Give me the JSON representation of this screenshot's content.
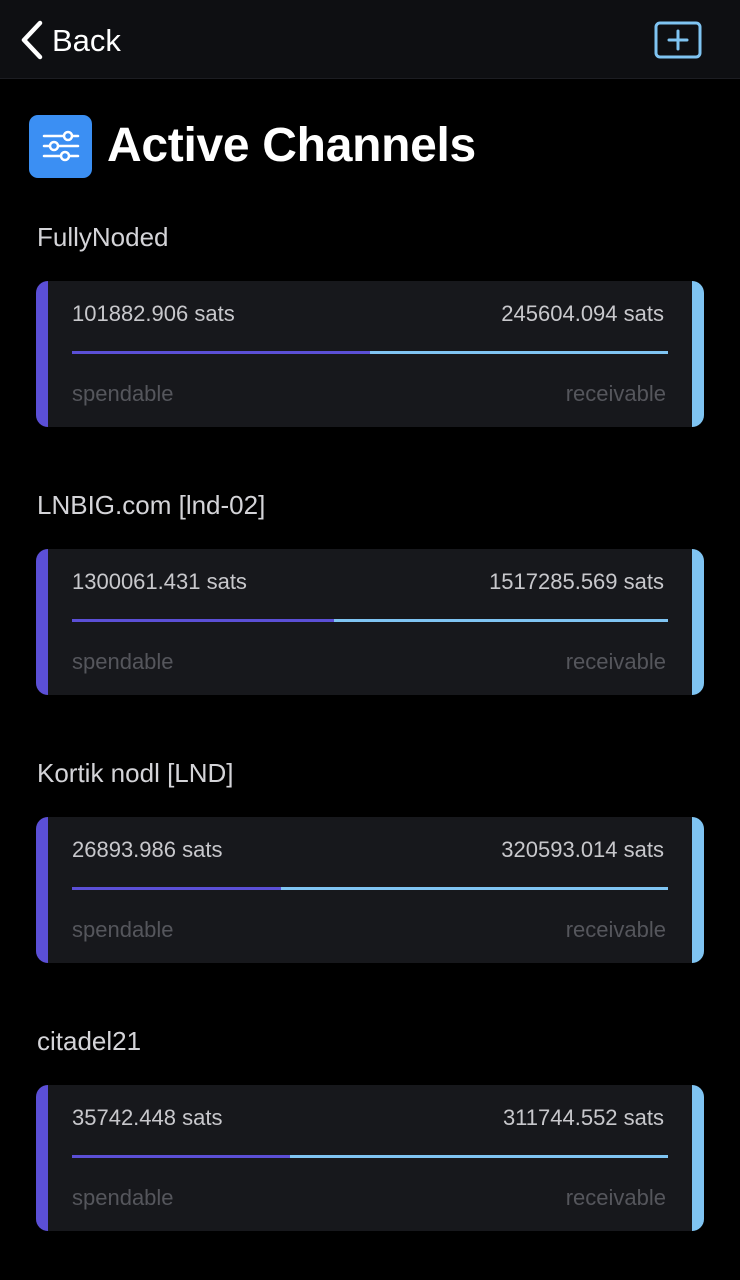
{
  "nav": {
    "back_label": "Back"
  },
  "header": {
    "title": "Active Channels"
  },
  "colors": {
    "spendable": "#5b4fd6",
    "receivable": "#7fc4f2",
    "title_icon_bg": "#3b8ff3",
    "add_icon": "#7fc4f2"
  },
  "icons": {
    "back": "chevron-left-icon",
    "add": "plus-square-icon",
    "title": "sliders-icon"
  },
  "channels": [
    {
      "name": "FullyNoded",
      "spendable_amount": "101882.906 sats",
      "receivable_amount": "245604.094 sats",
      "spendable_label": "spendable",
      "receivable_label": "receivable",
      "spendable_fraction": 0.5
    },
    {
      "name": "LNBIG.com [lnd-02]",
      "spendable_amount": "1300061.431 sats",
      "receivable_amount": "1517285.569 sats",
      "spendable_label": "spendable",
      "receivable_label": "receivable",
      "spendable_fraction": 0.44
    },
    {
      "name": "Kortik nodl [LND]",
      "spendable_amount": "26893.986 sats",
      "receivable_amount": "320593.014 sats",
      "spendable_label": "spendable",
      "receivable_label": "receivable",
      "spendable_fraction": 0.35
    },
    {
      "name": "citadel21",
      "spendable_amount": "35742.448 sats",
      "receivable_amount": "311744.552 sats",
      "spendable_label": "spendable",
      "receivable_label": "receivable",
      "spendable_fraction": 0.365
    }
  ]
}
